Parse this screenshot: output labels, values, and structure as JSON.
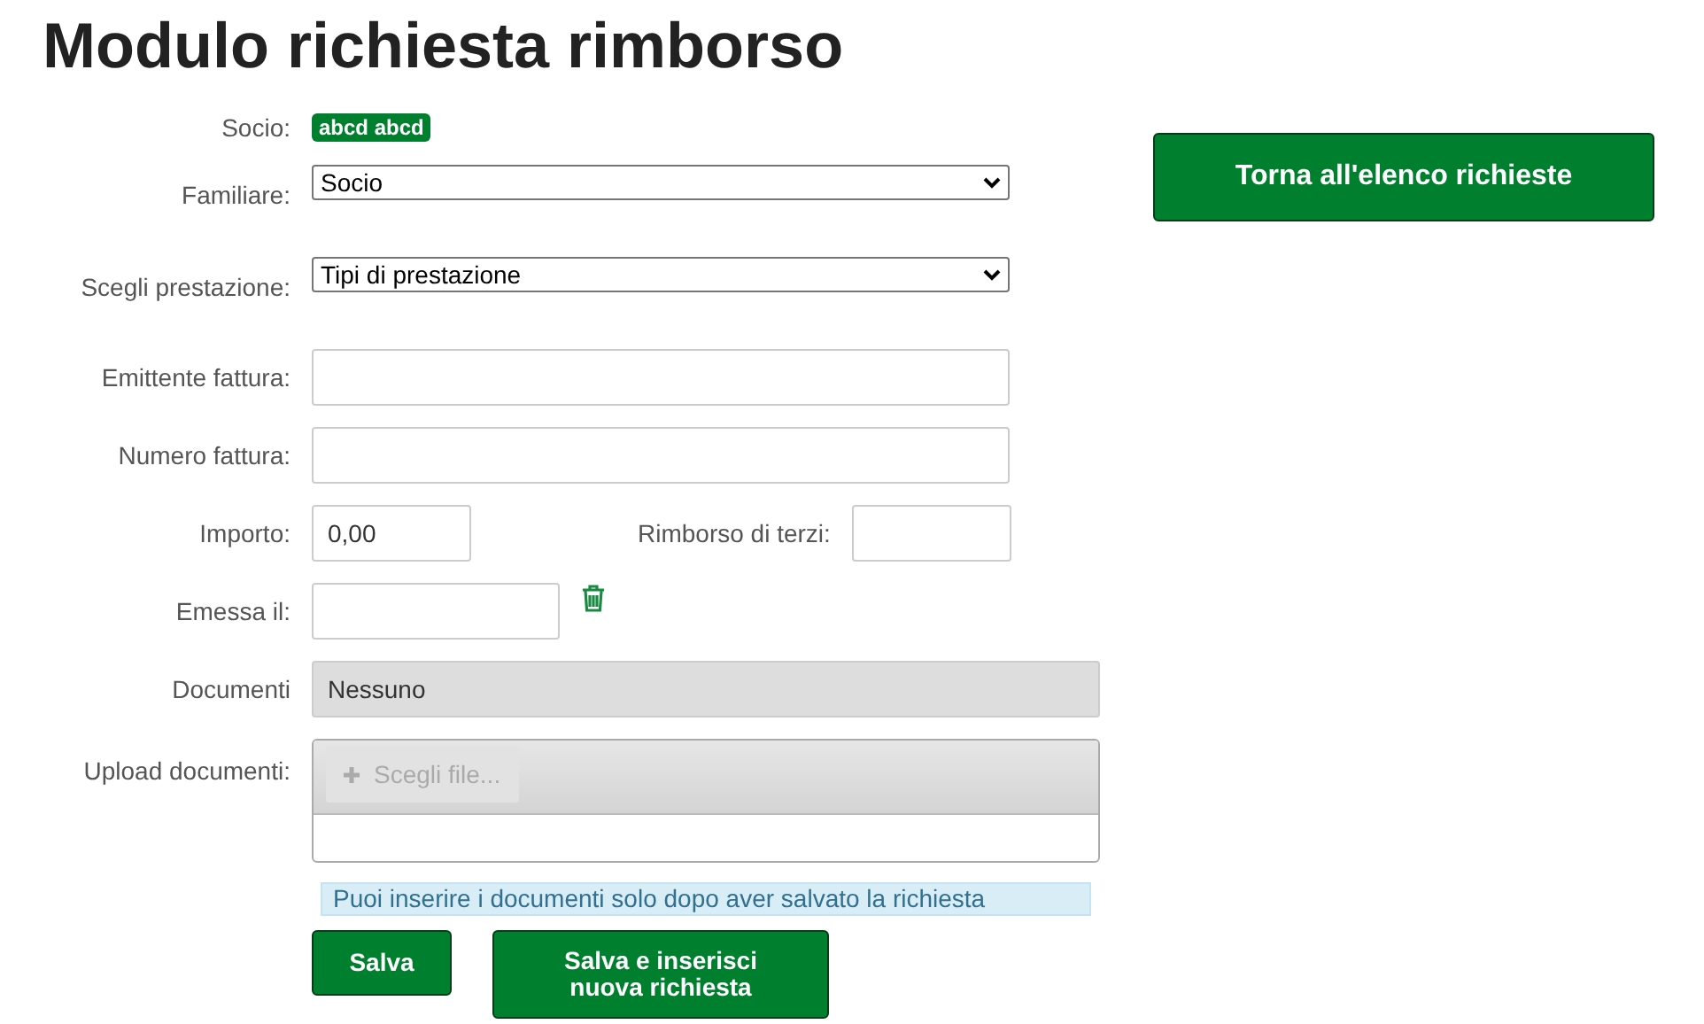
{
  "title": "Modulo richiesta rimborso",
  "socio": {
    "label": "Socio:",
    "badge": "abcd abcd"
  },
  "familiare": {
    "label": "Familiare:",
    "value": "Socio"
  },
  "prestazione": {
    "label": "Scegli prestazione:",
    "value": "Tipi di prestazione"
  },
  "emittente": {
    "label": "Emittente fattura:"
  },
  "numero": {
    "label": "Numero fattura:"
  },
  "importo": {
    "label": "Importo:",
    "value": "0,00"
  },
  "rimborso_terzi": {
    "label": "Rimborso di terzi:"
  },
  "emessa": {
    "label": "Emessa il:"
  },
  "documenti": {
    "label": "Documenti",
    "value": "Nessuno"
  },
  "upload": {
    "label": "Upload documenti:",
    "button": "Scegli file...",
    "disabled": true
  },
  "info": "Puoi inserire i documenti solo dopo aver salvato la richiesta",
  "buttons": [
    "Salva",
    "Salva e inserisci nuova richiesta"
  ],
  "back_button": "Torna all'elenco richieste"
}
